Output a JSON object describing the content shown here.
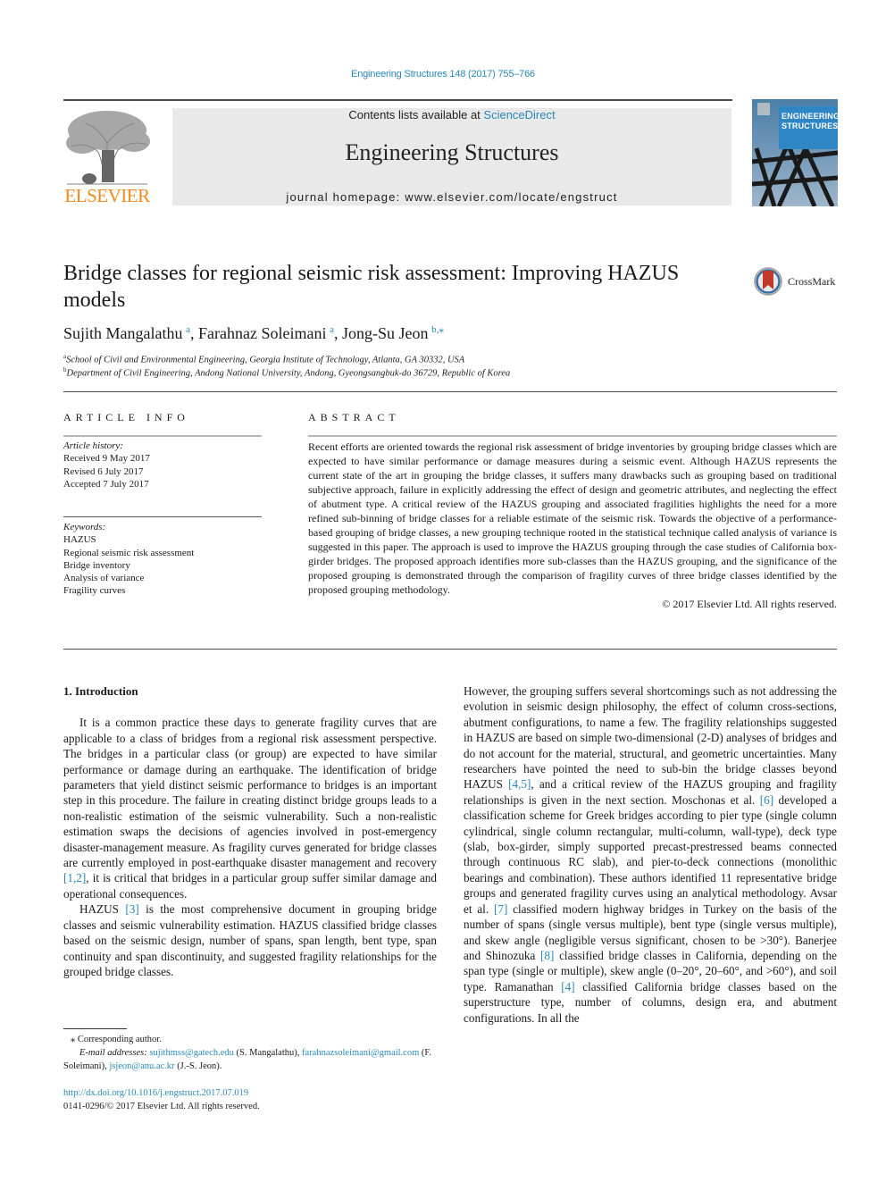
{
  "header": {
    "journal_ref": "Engineering Structures 148 (2017) 755–766",
    "contents_prefix": "Contents lists available at ",
    "contents_link": "ScienceDirect",
    "journal_title": "Engineering Structures",
    "homepage_prefix": "journal homepage: ",
    "homepage_url": "www.elsevier.com/locate/engstruct",
    "publisher_logo_text": "ELSEVIER",
    "cover_line1": "ENGINEERING",
    "cover_line2": "STRUCTURES",
    "colors": {
      "link": "#2a88b6",
      "elsevier_orange": "#f08a1c",
      "masthead_bg": "#e9e9e9"
    }
  },
  "article": {
    "title": "Bridge classes for regional seismic risk assessment: Improving HAZUS models",
    "crossmark_label": "CrossMark",
    "authors": [
      {
        "name": "Sujith Mangalathu",
        "sup": "a",
        "sep": ", "
      },
      {
        "name": "Farahnaz Soleimani",
        "sup": "a",
        "sep": ", "
      },
      {
        "name": "Jong-Su Jeon",
        "sup": "b,⁎",
        "sep": ""
      }
    ],
    "affiliations": [
      {
        "mark": "a",
        "text": "School of Civil and Environmental Engineering, Georgia Institute of Technology, Atlanta, GA 30332, USA"
      },
      {
        "mark": "b",
        "text": "Department of Civil Engineering, Andong National University, Andong, Gyeongsangbuk-do 36729, Republic of Korea"
      }
    ]
  },
  "article_info": {
    "heading": "ARTICLE INFO",
    "history_label": "Article history:",
    "history": [
      "Received 9 May 2017",
      "Revised 6 July 2017",
      "Accepted 7 July 2017"
    ],
    "keywords_label": "Keywords:",
    "keywords": [
      "HAZUS",
      "Regional seismic risk assessment",
      "Bridge inventory",
      "Analysis of variance",
      "Fragility curves"
    ]
  },
  "abstract": {
    "heading": "ABSTRACT",
    "text": "Recent efforts are oriented towards the regional risk assessment of bridge inventories by grouping bridge classes which are expected to have similar performance or damage measures during a seismic event. Although HAZUS represents the current state of the art in grouping the bridge classes, it suffers many drawbacks such as grouping based on traditional subjective approach, failure in explicitly addressing the effect of design and geometric attributes, and neglecting the effect of abutment type. A critical review of the HAZUS grouping and associated fragilities highlights the need for a more refined sub-binning of bridge classes for a reliable estimate of the seismic risk. Towards the objective of a performance-based grouping of bridge classes, a new grouping technique rooted in the statistical technique called analysis of variance is suggested in this paper. The approach is used to improve the HAZUS grouping through the case studies of California box-girder bridges. The proposed approach identifies more sub-classes than the HAZUS grouping, and the significance of the proposed grouping is demonstrated through the comparison of fragility curves of three bridge classes identified by the proposed grouping methodology.",
    "copyright": "© 2017 Elsevier Ltd. All rights reserved."
  },
  "body": {
    "section_heading": "1. Introduction",
    "left_p1_a": "It is a common practice these days to generate fragility curves that are applicable to a class of bridges from a regional risk assessment perspective. The bridges in a particular class (or group) are expected to have similar performance or damage during an earthquake. The identification of bridge parameters that yield distinct seismic performance to bridges is an important step in this procedure. The failure in creating distinct bridge groups leads to a non-realistic estimation of the seismic vulnerability. Such a non-realistic estimation swaps the decisions of agencies involved in post-emergency disaster-management measure. As fragility curves generated for bridge classes are currently employed in post-earthquake disaster management and recovery ",
    "left_p1_ref": "[1,2]",
    "left_p1_b": ", it is critical that bridges in a particular group suffer similar damage and operational consequences.",
    "left_p2_a": "HAZUS ",
    "left_p2_ref": "[3]",
    "left_p2_b": " is the most comprehensive document in grouping bridge classes and seismic vulnerability estimation. HAZUS classified bridge classes based on the seismic design, number of spans, span length, bent type, span continuity and span discontinuity, and suggested fragility relationships for the grouped bridge classes.",
    "right_s1": "However, the grouping suffers several shortcomings such as not addressing the evolution in seismic design philosophy, the effect of column cross-sections, abutment configurations, to name a few. The fragility relationships suggested in HAZUS are based on simple two-dimensional (2-D) analyses of bridges and do not account for the material, structural, and geometric uncertainties. Many researchers have pointed the need to sub-bin the bridge classes beyond HAZUS ",
    "right_ref1": "[4,5]",
    "right_s2": ", and a critical review of the HAZUS grouping and fragility relationships is given in the next section. Moschonas et al. ",
    "right_ref2": "[6]",
    "right_s3": " developed a classification scheme for Greek bridges according to pier type (single column cylindrical, single column rectangular, multi-column, wall-type), deck type (slab, box-girder, simply supported precast-prestressed beams connected through continuous RC slab), and pier-to-deck connections (monolithic bearings and combination). These authors identified 11 representative bridge groups and generated fragility curves using an analytical methodology. Avsar et al. ",
    "right_ref3": "[7]",
    "right_s4": " classified modern highway bridges in Turkey on the basis of the number of spans (single versus multiple), bent type (single versus multiple), and skew angle (negligible versus significant, chosen to be >30°). Banerjee and Shinozuka ",
    "right_ref4": "[8]",
    "right_s5": " classified bridge classes in California, depending on the span type (single or multiple), skew angle (0–20°, 20–60°, and >60°), and soil type. Ramanathan ",
    "right_ref5": "[4]",
    "right_s6": " classified California bridge classes based on the superstructure type, number of columns, design era, and abutment configurations. In all the"
  },
  "footnotes": {
    "corresponding": "⁎ Corresponding author.",
    "email_label": "E-mail addresses:",
    "email1": "sujithmss@gatech.edu",
    "email1_owner": " (S. Mangalathu), ",
    "email2": "farahnazsoleimani@gmail.com",
    "email2_owner": " (F. Soleimani), ",
    "email3": "jsjeon@anu.ac.kr",
    "email3_owner": " (J.-S. Jeon).",
    "doi": "http://dx.doi.org/10.1016/j.engstruct.2017.07.019",
    "issn_line": "0141-0296/© 2017 Elsevier Ltd. All rights reserved."
  }
}
